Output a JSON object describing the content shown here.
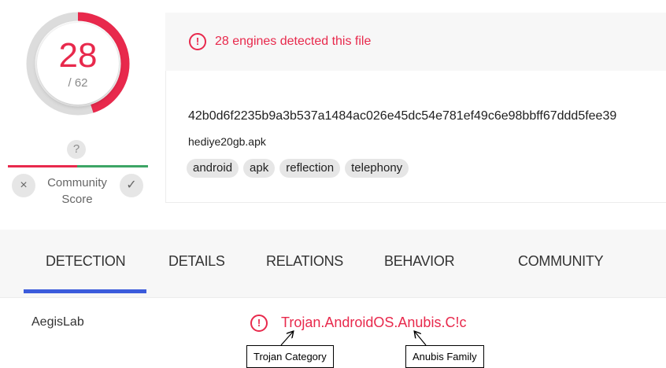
{
  "score": {
    "detected": "28",
    "total": "/ 62",
    "detected_count": 28,
    "total_count": 62,
    "colors": {
      "detected": "#e8294c",
      "undetected": "#d9d9d9"
    }
  },
  "community": {
    "unknown_glyph": "?",
    "label_line1": "Community",
    "label_line2": "Score",
    "down_glyph": "×",
    "up_glyph": "✓"
  },
  "alert": {
    "icon": "!",
    "text": "28 engines detected this file"
  },
  "file": {
    "hash": "42b0d6f2235b9a3b537a1484ac026e45dc54e781ef49c6e98bbff67ddd5fee39",
    "name": "hediye20gb.apk",
    "tags": [
      "android",
      "apk",
      "reflection",
      "telephony"
    ]
  },
  "tabs": [
    {
      "label": "DETECTION",
      "active": true
    },
    {
      "label": "DETAILS",
      "active": false
    },
    {
      "label": "RELATIONS",
      "active": false
    },
    {
      "label": "BEHAVIOR",
      "active": false
    },
    {
      "label": "COMMUNITY",
      "active": false
    }
  ],
  "detection": {
    "engine": "AegisLab",
    "icon": "!",
    "result": "Trojan.AndroidOS.Anubis.C!c"
  },
  "annotations": {
    "category": "Trojan Category",
    "family": "Anubis Family"
  },
  "colors": {
    "alert": "#e8294c",
    "tab_indicator": "#3b5bdb",
    "community_bad": "#e8294c",
    "community_good": "#3ca565"
  }
}
